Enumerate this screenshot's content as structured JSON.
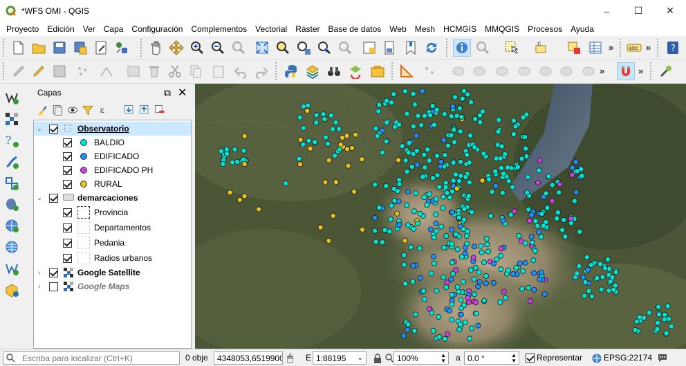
{
  "window": {
    "title": "*WFS OMI - QGIS",
    "minimize": "–",
    "maximize": "☐",
    "close": "✕"
  },
  "menu": [
    "Proyecto",
    "Edición",
    "Ver",
    "Capa",
    "Configuración",
    "Complementos",
    "Vectorial",
    "Ráster",
    "Base de datos",
    "Web",
    "Mesh",
    "HCMGIS",
    "MMQGIS",
    "Procesos",
    "Ayuda"
  ],
  "toolbar": {
    "overflow": "»",
    "abc_label": "abc"
  },
  "layers_panel": {
    "title": "Capas",
    "groups": [
      {
        "name": "Observatorio",
        "expanded": true,
        "checked": true,
        "selected": true,
        "items": [
          {
            "label": "BALDIO",
            "color": "#00e5d4"
          },
          {
            "label": "EDIFICADO",
            "color": "#1e90ff"
          },
          {
            "label": "EDIFICADO PH",
            "color": "#d040e0"
          },
          {
            "label": "RURAL",
            "color": "#e8c21a"
          }
        ]
      },
      {
        "name": "demarcaciones",
        "expanded": true,
        "checked": true,
        "items": [
          {
            "label": "Provincia"
          },
          {
            "label": "Departamentos"
          },
          {
            "label": "Pedania"
          },
          {
            "label": "Radios urbanos"
          }
        ]
      },
      {
        "name": "Google Satellite",
        "expanded": false,
        "checked": true
      },
      {
        "name": "Google Maps",
        "expanded": false,
        "checked": false
      }
    ]
  },
  "status": {
    "locator_placeholder": "Escriba para localizar (Ctrl+K)",
    "objects": "0 obje",
    "coordinate": "4348053,6519900",
    "scale_label": "E",
    "scale": "1:88195",
    "magnifier": "100%",
    "rotation_label": "a",
    "rotation": "0.0 °",
    "render_label": "Representar",
    "crs": "EPSG:22174"
  },
  "colors": {
    "baldio": "#00e5d4",
    "edificado": "#1e90ff",
    "edificado_ph": "#d040e0",
    "rural": "#e8c21a"
  }
}
